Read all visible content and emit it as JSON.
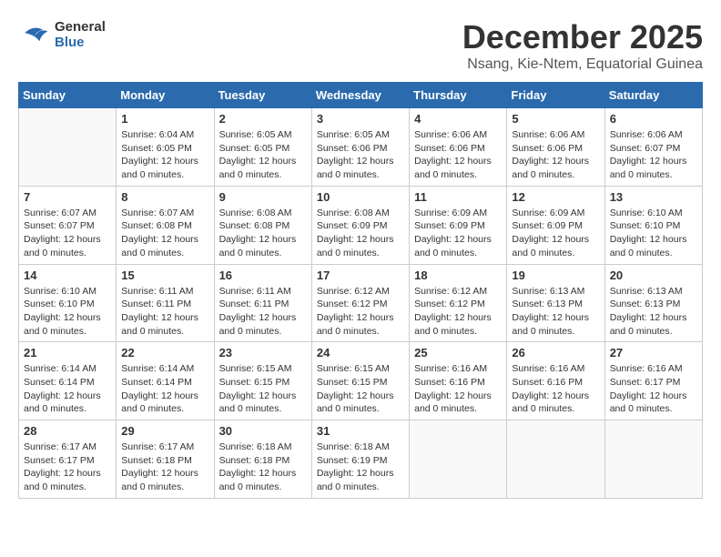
{
  "logo": {
    "line1": "General",
    "line2": "Blue"
  },
  "title": "December 2025",
  "location": "Nsang, Kie-Ntem, Equatorial Guinea",
  "days_of_week": [
    "Sunday",
    "Monday",
    "Tuesday",
    "Wednesday",
    "Thursday",
    "Friday",
    "Saturday"
  ],
  "weeks": [
    [
      {
        "day": "",
        "info": ""
      },
      {
        "day": "1",
        "info": "Sunrise: 6:04 AM\nSunset: 6:05 PM\nDaylight: 12 hours\nand 0 minutes."
      },
      {
        "day": "2",
        "info": "Sunrise: 6:05 AM\nSunset: 6:05 PM\nDaylight: 12 hours\nand 0 minutes."
      },
      {
        "day": "3",
        "info": "Sunrise: 6:05 AM\nSunset: 6:06 PM\nDaylight: 12 hours\nand 0 minutes."
      },
      {
        "day": "4",
        "info": "Sunrise: 6:06 AM\nSunset: 6:06 PM\nDaylight: 12 hours\nand 0 minutes."
      },
      {
        "day": "5",
        "info": "Sunrise: 6:06 AM\nSunset: 6:06 PM\nDaylight: 12 hours\nand 0 minutes."
      },
      {
        "day": "6",
        "info": "Sunrise: 6:06 AM\nSunset: 6:07 PM\nDaylight: 12 hours\nand 0 minutes."
      }
    ],
    [
      {
        "day": "7",
        "info": "Sunrise: 6:07 AM\nSunset: 6:07 PM\nDaylight: 12 hours\nand 0 minutes."
      },
      {
        "day": "8",
        "info": "Sunrise: 6:07 AM\nSunset: 6:08 PM\nDaylight: 12 hours\nand 0 minutes."
      },
      {
        "day": "9",
        "info": "Sunrise: 6:08 AM\nSunset: 6:08 PM\nDaylight: 12 hours\nand 0 minutes."
      },
      {
        "day": "10",
        "info": "Sunrise: 6:08 AM\nSunset: 6:09 PM\nDaylight: 12 hours\nand 0 minutes."
      },
      {
        "day": "11",
        "info": "Sunrise: 6:09 AM\nSunset: 6:09 PM\nDaylight: 12 hours\nand 0 minutes."
      },
      {
        "day": "12",
        "info": "Sunrise: 6:09 AM\nSunset: 6:09 PM\nDaylight: 12 hours\nand 0 minutes."
      },
      {
        "day": "13",
        "info": "Sunrise: 6:10 AM\nSunset: 6:10 PM\nDaylight: 12 hours\nand 0 minutes."
      }
    ],
    [
      {
        "day": "14",
        "info": "Sunrise: 6:10 AM\nSunset: 6:10 PM\nDaylight: 12 hours\nand 0 minutes."
      },
      {
        "day": "15",
        "info": "Sunrise: 6:11 AM\nSunset: 6:11 PM\nDaylight: 12 hours\nand 0 minutes."
      },
      {
        "day": "16",
        "info": "Sunrise: 6:11 AM\nSunset: 6:11 PM\nDaylight: 12 hours\nand 0 minutes."
      },
      {
        "day": "17",
        "info": "Sunrise: 6:12 AM\nSunset: 6:12 PM\nDaylight: 12 hours\nand 0 minutes."
      },
      {
        "day": "18",
        "info": "Sunrise: 6:12 AM\nSunset: 6:12 PM\nDaylight: 12 hours\nand 0 minutes."
      },
      {
        "day": "19",
        "info": "Sunrise: 6:13 AM\nSunset: 6:13 PM\nDaylight: 12 hours\nand 0 minutes."
      },
      {
        "day": "20",
        "info": "Sunrise: 6:13 AM\nSunset: 6:13 PM\nDaylight: 12 hours\nand 0 minutes."
      }
    ],
    [
      {
        "day": "21",
        "info": "Sunrise: 6:14 AM\nSunset: 6:14 PM\nDaylight: 12 hours\nand 0 minutes."
      },
      {
        "day": "22",
        "info": "Sunrise: 6:14 AM\nSunset: 6:14 PM\nDaylight: 12 hours\nand 0 minutes."
      },
      {
        "day": "23",
        "info": "Sunrise: 6:15 AM\nSunset: 6:15 PM\nDaylight: 12 hours\nand 0 minutes."
      },
      {
        "day": "24",
        "info": "Sunrise: 6:15 AM\nSunset: 6:15 PM\nDaylight: 12 hours\nand 0 minutes."
      },
      {
        "day": "25",
        "info": "Sunrise: 6:16 AM\nSunset: 6:16 PM\nDaylight: 12 hours\nand 0 minutes."
      },
      {
        "day": "26",
        "info": "Sunrise: 6:16 AM\nSunset: 6:16 PM\nDaylight: 12 hours\nand 0 minutes."
      },
      {
        "day": "27",
        "info": "Sunrise: 6:16 AM\nSunset: 6:17 PM\nDaylight: 12 hours\nand 0 minutes."
      }
    ],
    [
      {
        "day": "28",
        "info": "Sunrise: 6:17 AM\nSunset: 6:17 PM\nDaylight: 12 hours\nand 0 minutes."
      },
      {
        "day": "29",
        "info": "Sunrise: 6:17 AM\nSunset: 6:18 PM\nDaylight: 12 hours\nand 0 minutes."
      },
      {
        "day": "30",
        "info": "Sunrise: 6:18 AM\nSunset: 6:18 PM\nDaylight: 12 hours\nand 0 minutes."
      },
      {
        "day": "31",
        "info": "Sunrise: 6:18 AM\nSunset: 6:19 PM\nDaylight: 12 hours\nand 0 minutes."
      },
      {
        "day": "",
        "info": ""
      },
      {
        "day": "",
        "info": ""
      },
      {
        "day": "",
        "info": ""
      }
    ]
  ]
}
